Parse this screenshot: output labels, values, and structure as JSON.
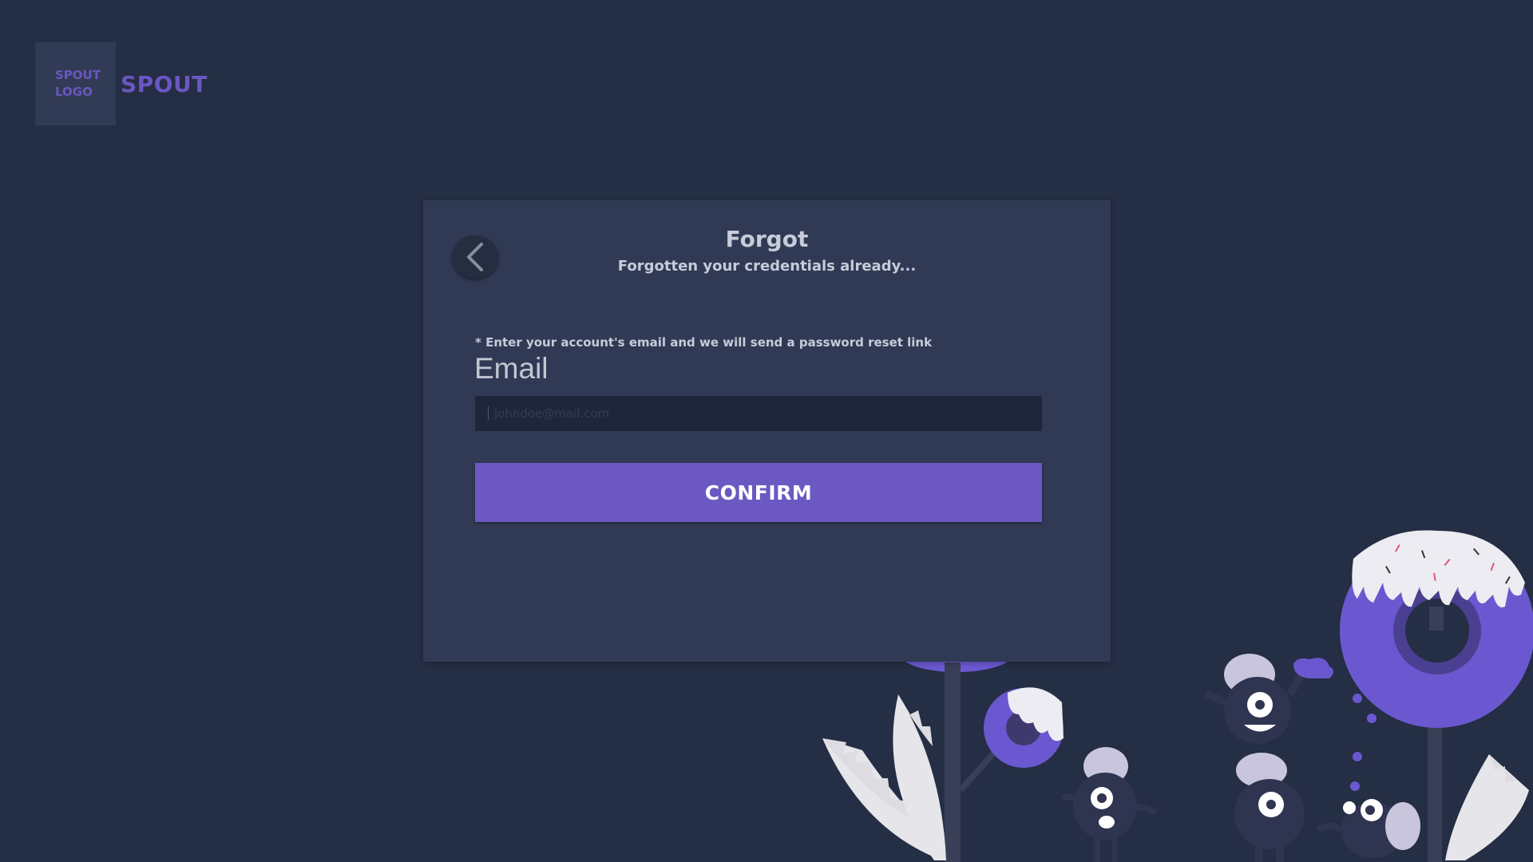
{
  "logo": {
    "line1": "SPOUT",
    "line2": "LOGO",
    "brand_name": "SPOUT"
  },
  "card": {
    "title": "Forgot",
    "subtitle": "Forgotten your credentials already...",
    "hint": "* Enter your account's email and we will send a password reset link",
    "email_label": "Email",
    "email_placeholder": "johndoe@mail.com",
    "email_value": "",
    "confirm_label": "CONFIRM"
  },
  "colors": {
    "background": "#242e44",
    "card": "#303a55",
    "accent": "#6c58c2",
    "input_bg": "#1e263a",
    "text": "#c7ccd9"
  },
  "icons": {
    "back": "chevron-left-icon"
  }
}
